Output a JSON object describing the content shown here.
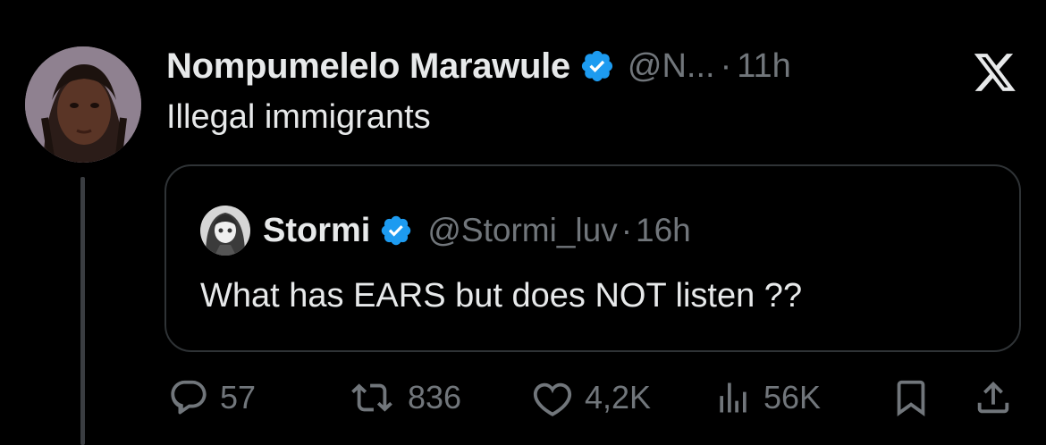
{
  "tweet": {
    "author_name": "Nompumelelo Marawule",
    "verified": true,
    "handle": "@N...",
    "dot": "·",
    "time": "11h",
    "text": "Illegal immigrants"
  },
  "quoted_tweet": {
    "author_name": "Stormi",
    "verified": true,
    "handle": "@Stormi_luv",
    "dot": "·",
    "time": "16h",
    "text": "What has EARS but does NOT listen ??"
  },
  "actions": {
    "replies": "57",
    "reposts": "836",
    "likes": "4,2K",
    "views": "56K"
  },
  "icons": [
    "x-logo-icon",
    "verified-badge-icon",
    "reply-icon",
    "repost-icon",
    "like-icon",
    "views-icon",
    "bookmark-icon",
    "share-icon"
  ],
  "colors": {
    "background": "#000000",
    "text": "#e7e9ea",
    "secondary": "#71767b",
    "verified": "#1d9bf0",
    "border": "#2f3336"
  }
}
